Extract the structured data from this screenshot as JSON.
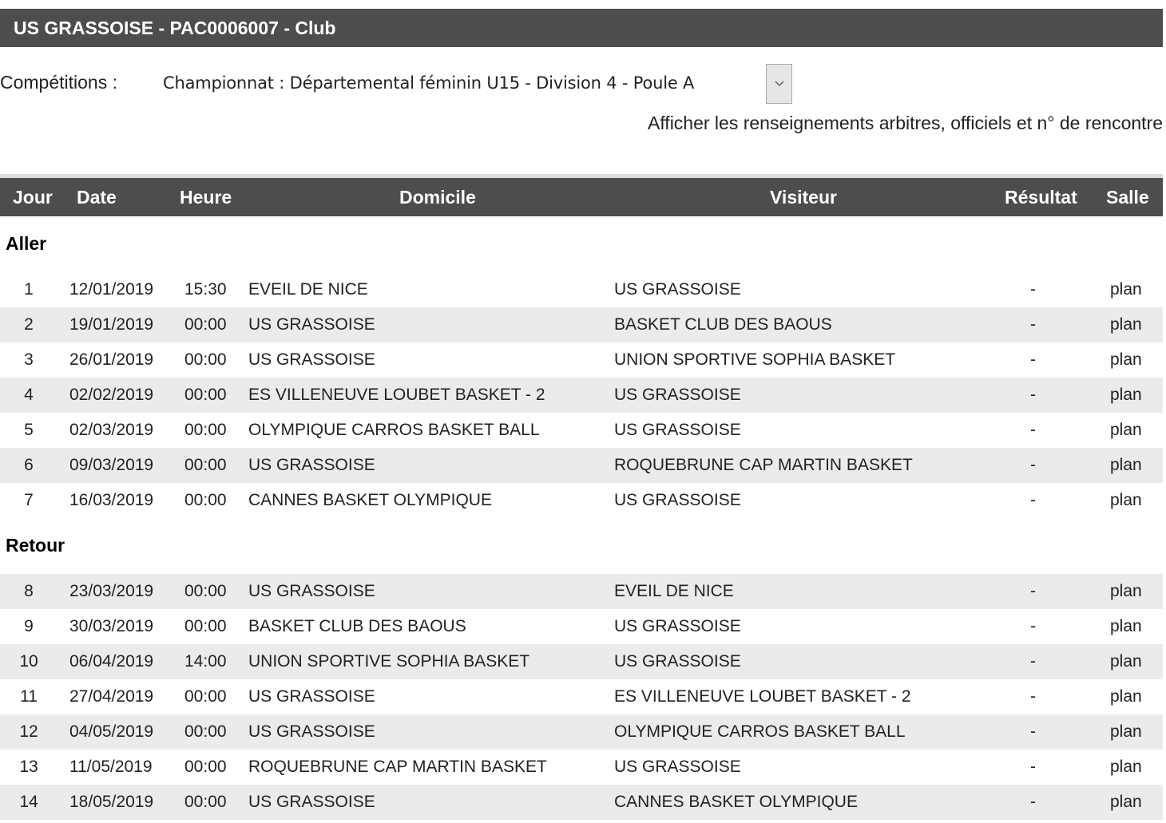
{
  "page": {
    "title": "US GRASSOISE - PAC0006007 - Club",
    "competitions_label": "Compétitions :",
    "competition_selected": "Championnat : Départemental féminin U15 - Division 4 - Poule A",
    "toggle_text": "Afficher les renseignements arbitres, officiels et n° de rencontre"
  },
  "table": {
    "headers": {
      "jour": "Jour",
      "date": "Date",
      "heure": "Heure",
      "domicile": "Domicile",
      "visiteur": "Visiteur",
      "resultat": "Résultat",
      "salle": "Salle"
    },
    "sections": [
      {
        "title": "Aller",
        "rows": [
          {
            "jour": "1",
            "date": "12/01/2019",
            "heure": "15:30",
            "domicile": "EVEIL DE NICE",
            "visiteur": "US GRASSOISE",
            "resultat": "-",
            "salle": "plan"
          },
          {
            "jour": "2",
            "date": "19/01/2019",
            "heure": "00:00",
            "domicile": "US GRASSOISE",
            "visiteur": "BASKET CLUB DES BAOUS",
            "resultat": "-",
            "salle": "plan"
          },
          {
            "jour": "3",
            "date": "26/01/2019",
            "heure": "00:00",
            "domicile": "US GRASSOISE",
            "visiteur": "UNION SPORTIVE SOPHIA BASKET",
            "resultat": "-",
            "salle": "plan"
          },
          {
            "jour": "4",
            "date": "02/02/2019",
            "heure": "00:00",
            "domicile": "ES VILLENEUVE LOUBET BASKET - 2",
            "visiteur": "US GRASSOISE",
            "resultat": "-",
            "salle": "plan"
          },
          {
            "jour": "5",
            "date": "02/03/2019",
            "heure": "00:00",
            "domicile": "OLYMPIQUE CARROS BASKET BALL",
            "visiteur": "US GRASSOISE",
            "resultat": "-",
            "salle": "plan"
          },
          {
            "jour": "6",
            "date": "09/03/2019",
            "heure": "00:00",
            "domicile": "US GRASSOISE",
            "visiteur": "ROQUEBRUNE CAP MARTIN BASKET",
            "resultat": "-",
            "salle": "plan"
          },
          {
            "jour": "7",
            "date": "16/03/2019",
            "heure": "00:00",
            "domicile": "CANNES BASKET OLYMPIQUE",
            "visiteur": "US GRASSOISE",
            "resultat": "-",
            "salle": "plan"
          }
        ]
      },
      {
        "title": "Retour",
        "rows": [
          {
            "jour": "8",
            "date": "23/03/2019",
            "heure": "00:00",
            "domicile": "US GRASSOISE",
            "visiteur": "EVEIL DE NICE",
            "resultat": "-",
            "salle": "plan"
          },
          {
            "jour": "9",
            "date": "30/03/2019",
            "heure": "00:00",
            "domicile": "BASKET CLUB DES BAOUS",
            "visiteur": "US GRASSOISE",
            "resultat": "-",
            "salle": "plan"
          },
          {
            "jour": "10",
            "date": "06/04/2019",
            "heure": "14:00",
            "domicile": "UNION SPORTIVE SOPHIA BASKET",
            "visiteur": "US GRASSOISE",
            "resultat": "-",
            "salle": "plan"
          },
          {
            "jour": "11",
            "date": "27/04/2019",
            "heure": "00:00",
            "domicile": "US GRASSOISE",
            "visiteur": "ES VILLENEUVE LOUBET BASKET - 2",
            "resultat": "-",
            "salle": "plan"
          },
          {
            "jour": "12",
            "date": "04/05/2019",
            "heure": "00:00",
            "domicile": "US GRASSOISE",
            "visiteur": "OLYMPIQUE CARROS BASKET BALL",
            "resultat": "-",
            "salle": "plan"
          },
          {
            "jour": "13",
            "date": "11/05/2019",
            "heure": "00:00",
            "domicile": "ROQUEBRUNE CAP MARTIN BASKET",
            "visiteur": "US GRASSOISE",
            "resultat": "-",
            "salle": "plan"
          },
          {
            "jour": "14",
            "date": "18/05/2019",
            "heure": "00:00",
            "domicile": "US GRASSOISE",
            "visiteur": "CANNES BASKET OLYMPIQUE",
            "resultat": "-",
            "salle": "plan"
          }
        ]
      }
    ]
  }
}
